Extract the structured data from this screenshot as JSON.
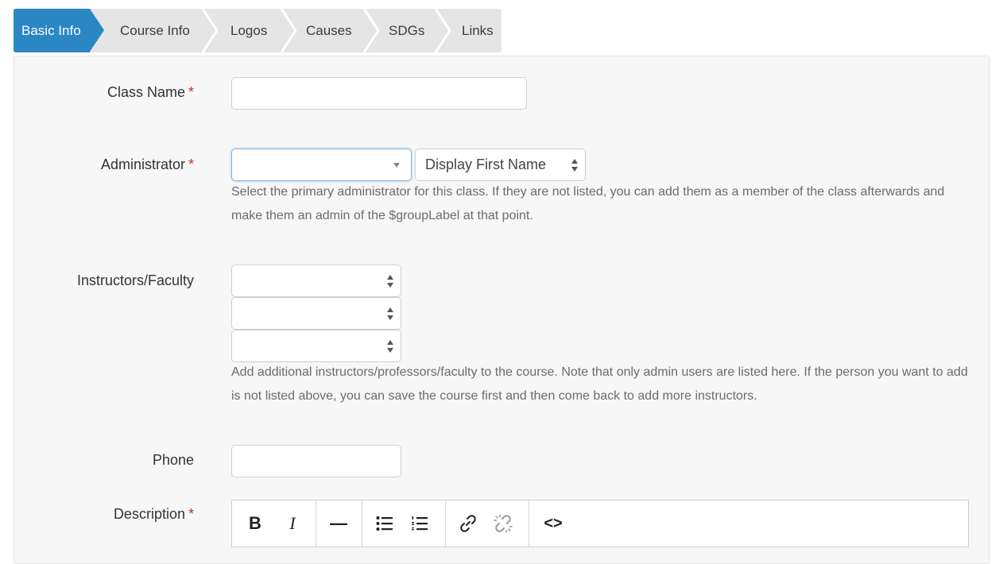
{
  "tabs": [
    {
      "label": "Basic Info",
      "active": true
    },
    {
      "label": "Course Info"
    },
    {
      "label": "Logos"
    },
    {
      "label": "Causes"
    },
    {
      "label": "SDGs"
    },
    {
      "label": "Links"
    }
  ],
  "form": {
    "required_mark": "*",
    "class_name": {
      "label": "Class Name",
      "value": ""
    },
    "administrator": {
      "label": "Administrator",
      "value": "",
      "display_select": "Display First Name",
      "help": "Select the primary administrator for this class. If they are not listed, you can add them as a member of the class afterwards and make them an admin of the $groupLabel at that point."
    },
    "instructors": {
      "label": "Instructors/Faculty",
      "selects": [
        "",
        "",
        ""
      ],
      "help": "Add additional instructors/professors/faculty to the course. Note that only admin users are listed here. If the person you want to add is not listed above, you can save the course first and then come back to add more instructors."
    },
    "phone": {
      "label": "Phone",
      "value": ""
    },
    "description": {
      "label": "Description"
    }
  },
  "toolbar": {
    "bold": "B",
    "italic": "I",
    "hr": "—",
    "code": "<>"
  },
  "colors": {
    "accent": "#2b86c4",
    "required": "#c9302c"
  }
}
